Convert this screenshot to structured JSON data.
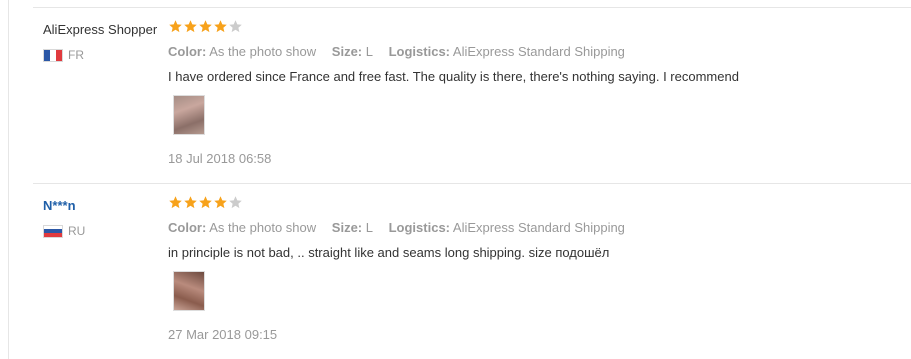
{
  "colors": {
    "star_filled": "#f7a21b",
    "star_empty": "#cccccc",
    "link": "#1f5fa8",
    "muted": "#999999",
    "text": "#333333"
  },
  "reviews": [
    {
      "user": "AliExpress Shopper",
      "country": "FR",
      "flag": "france-flag",
      "rating": 4,
      "max_rating": 5,
      "color_label": "Color:",
      "color_value": "As the photo show",
      "size_label": "Size:",
      "size_value": "L",
      "logistics_label": "Logistics:",
      "logistics_value": "AliExpress Standard Shipping",
      "feedback": "I have ordered since France and free fast. The quality is there, there's nothing saying. I recommend",
      "date": "18 Jul 2018 06:58"
    },
    {
      "user": "N***n",
      "country": "RU",
      "flag": "russia-flag",
      "rating": 4,
      "max_rating": 5,
      "color_label": "Color:",
      "color_value": "As the photo show",
      "size_label": "Size:",
      "size_value": "L",
      "logistics_label": "Logistics:",
      "logistics_value": "AliExpress Standard Shipping",
      "feedback": "in principle is not bad, .. straight like and seams long shipping. size подошёл",
      "date": "27 Mar 2018 09:15"
    }
  ]
}
